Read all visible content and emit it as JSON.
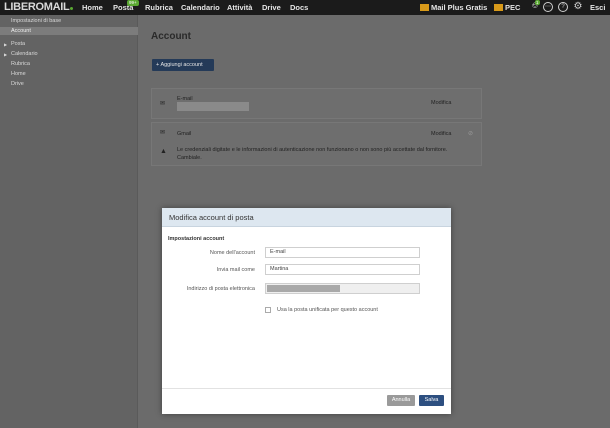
{
  "topbar": {
    "logo": "LIBEROMAIL",
    "nav": [
      "Home",
      "Posta",
      "Rubrica",
      "Calendario",
      "Attività",
      "Drive",
      "Docs"
    ],
    "posta_badge": "99+",
    "mail_plus": "Mail Plus Gratis",
    "pec": "PEC",
    "notif_count": "1",
    "esci": "Esci"
  },
  "sidebar": {
    "items": [
      "Impostazioni di base",
      "Account",
      "Posta",
      "Calendario",
      "Rubrica",
      "Home",
      "Drive"
    ]
  },
  "main": {
    "title": "Account",
    "add_button": "Aggiungi account",
    "email_label": "E-mail",
    "modify1": "Modifica",
    "gmail_label": "Gmail",
    "modify2": "Modifica",
    "warning_line1": "Le credenziali digitate e le informazioni di autenticazione non funzionano o non sono più accettate dal fornitore.",
    "warning_line2": "Cambiale."
  },
  "dialog": {
    "title": "Modifica account di posta",
    "section": "Impostazioni account",
    "name_label": "Nome dell'account",
    "name_value": "E-mail",
    "send_label": "Invia mail come",
    "send_value": "Martina",
    "address_label": "Indirizzo di posta elettronica",
    "unified_label": "Usa la posta unificata per questo account",
    "cancel": "Annulla",
    "save": "Salva"
  },
  "colors": {
    "topbar": "#1b1b1b",
    "accent_blue": "#243a58",
    "logo_green": "#5aa832",
    "mail_orange": "#d89a1a"
  }
}
